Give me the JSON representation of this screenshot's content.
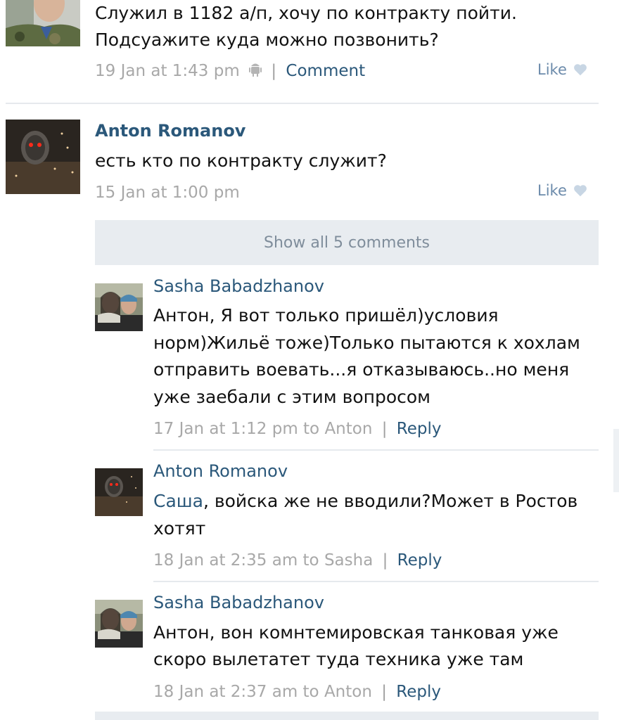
{
  "post1": {
    "text_line1": "Служил в 1182 а/п, хочу по контракту пойти.",
    "text_line2": "Подсуажите куда можно позвонить?",
    "date": "19 Jan at 1:43 pm",
    "separator": "|",
    "comment_link": "Comment",
    "like_label": "Like",
    "device_icon": "android-icon"
  },
  "post2": {
    "author": "Anton Romanov",
    "text": "есть кто по контракту служит?",
    "date": "15 Jan at 1:00 pm",
    "like_label": "Like"
  },
  "show_all": "Show all 5 comments",
  "comments": [
    {
      "author": "Sasha Babadzhanov",
      "lines": [
        "Антон, Я вот только пришёл)условия",
        "норм)Жильё тоже)Только пытаются к хохлам",
        "отправить воевать...я отказываюсь..но меня",
        "уже заебали с этим вопросом"
      ],
      "meta": "17 Jan at 1:12 pm to Anton",
      "separator": "|",
      "reply": "Reply"
    },
    {
      "author": "Anton Romanov",
      "mention": "Саша",
      "line1_rest": ", войска же не вводили?Может в Ростов",
      "line2": "хотят",
      "meta": "18 Jan at 2:35 am to Sasha",
      "separator": "|",
      "reply": "Reply"
    },
    {
      "author": "Sasha Babadzhanov",
      "lines": [
        "Антон, вон комнтемировская танковая уже",
        "скоро вылетатет туда техника уже там"
      ],
      "meta": "18 Jan at 2:37 am to Anton",
      "separator": "|",
      "reply": "Reply"
    }
  ],
  "colors": {
    "link": "#2b587a",
    "meta": "#a8a8a8",
    "show_all_bg": "#e8ecf0",
    "like": "#6c8bab"
  }
}
